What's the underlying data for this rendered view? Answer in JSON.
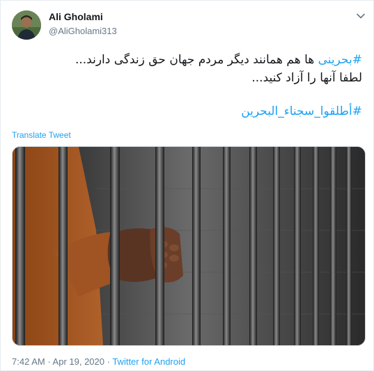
{
  "tweet": {
    "author_name": "Ali Gholami",
    "author_handle": "@AliGholami313",
    "hashtag1": "#بحرینی",
    "line1_rest": " ها هم همانند دیگر مردم جهان حق زندگی دارند...",
    "line2": "لطفا آنها را آزاد کنید...",
    "hashtag2": "#أطلقوا_سجناء_البحرين",
    "translate_label": "Translate Tweet",
    "time": "7:42 AM",
    "date": "Apr 19, 2020",
    "separator": " · ",
    "source": "Twitter for Android"
  },
  "icons": {
    "avatar": "profile-photo",
    "caret": "chevron-down-icon",
    "media": "prison-bars-photo"
  },
  "colors": {
    "link": "#1da1f2",
    "text": "#14171a",
    "muted": "#657786",
    "border": "#e6ecf0"
  }
}
